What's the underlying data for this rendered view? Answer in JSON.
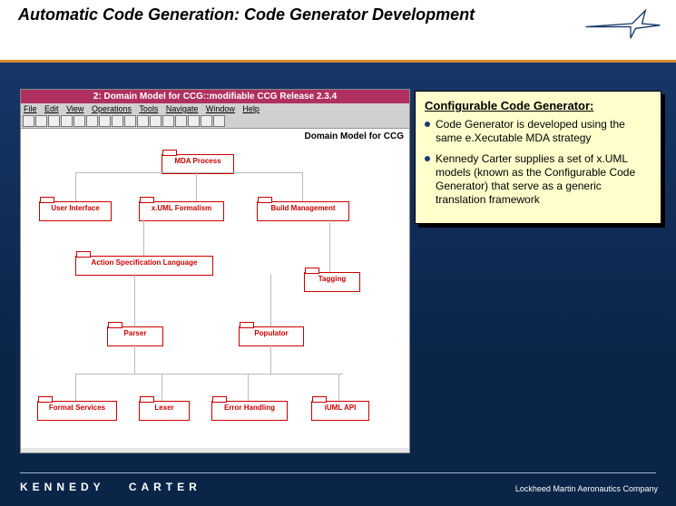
{
  "header": {
    "title": "Automatic Code Generation: Code Generator Development"
  },
  "window": {
    "title": "2: Domain Model for CCG::modifiable CCG Release 2.3.4",
    "menus": {
      "m0": "File",
      "m1": "Edit",
      "m2": "View",
      "m3": "Operations",
      "m4": "Tools",
      "m5": "Navigate",
      "m6": "Window",
      "m7": "Help"
    },
    "canvas_title": "Domain Model for CCG"
  },
  "packages": {
    "mda": "MDA Process",
    "ui": "User Interface",
    "xuml": "x.UML Formalism",
    "build": "Build Management",
    "asl": "Action Specification Language",
    "tag": "Tagging",
    "parser": "Parser",
    "pop": "Populator",
    "fmt": "Format Services",
    "lexer": "Lexer",
    "err": "Error Handling",
    "api": "iUML API"
  },
  "info": {
    "heading": "Configurable Code Generator:",
    "b1": "Code Generator is developed using the same e.Xecutable MDA strategy",
    "b2": "Kennedy Carter supplies a set of x.UML models (known as the Configurable Code Generator) that serve as a generic translation framework"
  },
  "footer": {
    "brand_a": "KENNEDY",
    "brand_b": "CARTER",
    "copyright": "Lockheed Martin Aeronautics Company"
  }
}
